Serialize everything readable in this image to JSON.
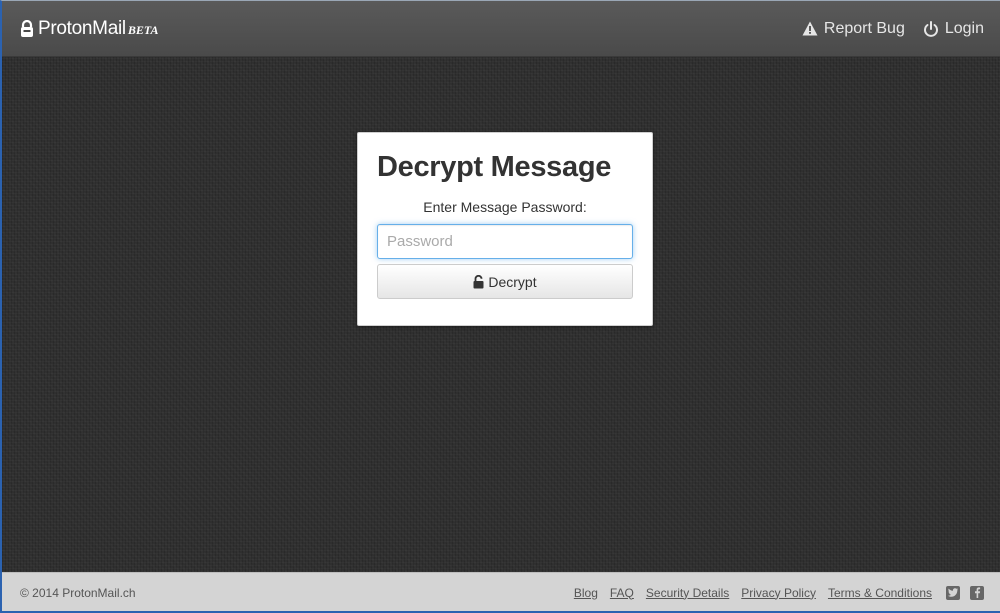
{
  "header": {
    "brand_name": "ProtonMail",
    "brand_tag": "BETA",
    "report_bug_label": "Report Bug",
    "login_label": "Login"
  },
  "card": {
    "title": "Decrypt Message",
    "prompt": "Enter Message Password:",
    "password_placeholder": "Password",
    "decrypt_label": "Decrypt"
  },
  "footer": {
    "copyright": "© 2014 ProtonMail.ch",
    "links": [
      "Blog",
      "FAQ",
      "Security Details",
      "Privacy Policy",
      "Terms & Conditions"
    ],
    "social": [
      "twitter-icon",
      "facebook-icon"
    ]
  },
  "colors": {
    "header_bg": "#4a4a4a",
    "page_bg": "#2f2f2f",
    "footer_bg": "#d4d4d4",
    "input_focus": "#66afe9"
  }
}
